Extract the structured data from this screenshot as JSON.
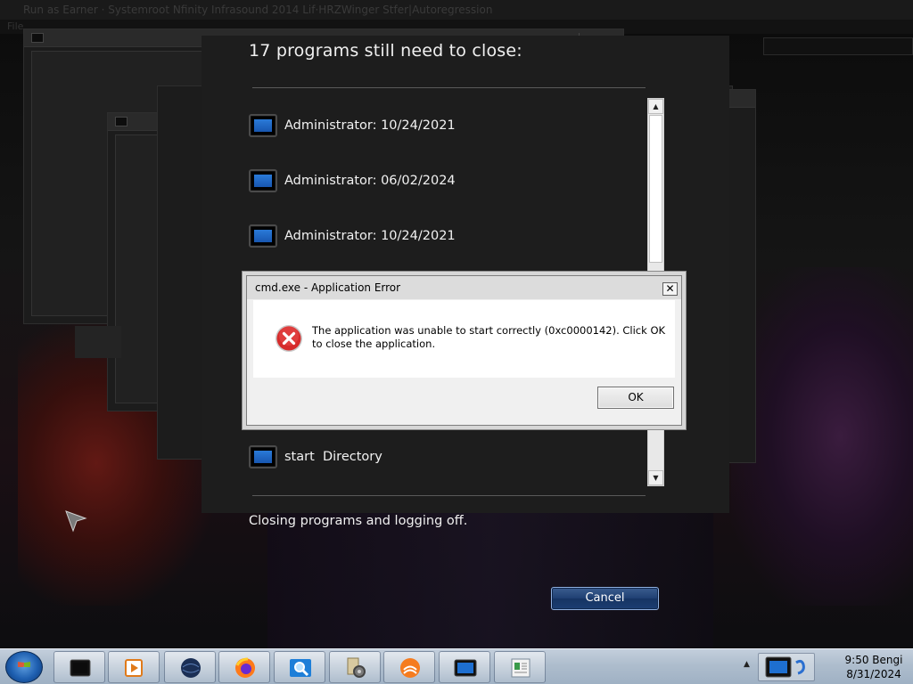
{
  "background": {
    "titlebar_text": "Run as Earner · Systemroot Nfinity Infrasound 2014 Lif·HRZWinger Stfer|Autoregression",
    "menubar_text": "File"
  },
  "shutdown": {
    "heading": "17 programs still need to close:",
    "programs": [
      {
        "label": "Administrator: 10/24/2021",
        "icon": "console-window-icon"
      },
      {
        "label": "Administrator: 06/02/2024",
        "icon": "console-window-icon"
      },
      {
        "label": "Administrator: 10/24/2021",
        "icon": "console-window-icon"
      },
      {
        "label": "start  Directory",
        "icon": "console-window-icon"
      }
    ],
    "status_text": "Closing programs and logging off.",
    "cancel_label": "Cancel",
    "scroll_up_glyph": "▲",
    "scroll_down_glyph": "▼"
  },
  "dialog": {
    "title": "cmd.exe - Application Error",
    "close_glyph": "✕",
    "icon": "error-icon",
    "message": "The application was unable to start correctly (0xc0000142). Click OK to close the application.",
    "ok_label": "OK"
  },
  "taskbar": {
    "start_icon": "windows-orb-icon",
    "buttons": [
      {
        "name": "console-window-icon"
      },
      {
        "name": "media-player-icon"
      },
      {
        "name": "globe-browser-icon"
      },
      {
        "name": "firefox-icon"
      },
      {
        "name": "magnifier-icon"
      },
      {
        "name": "settings-gear-icon"
      },
      {
        "name": "java-icon"
      },
      {
        "name": "console-window-icon"
      },
      {
        "name": "notepad-icon"
      }
    ],
    "tray_arrow": "▲",
    "clock_time": "9:50 Bengi",
    "clock_date": "8/31/2024"
  },
  "colors": {
    "accent_blue": "#1f3f72",
    "error_red": "#d62b2b",
    "pane_bg": "#1d1d1d"
  }
}
